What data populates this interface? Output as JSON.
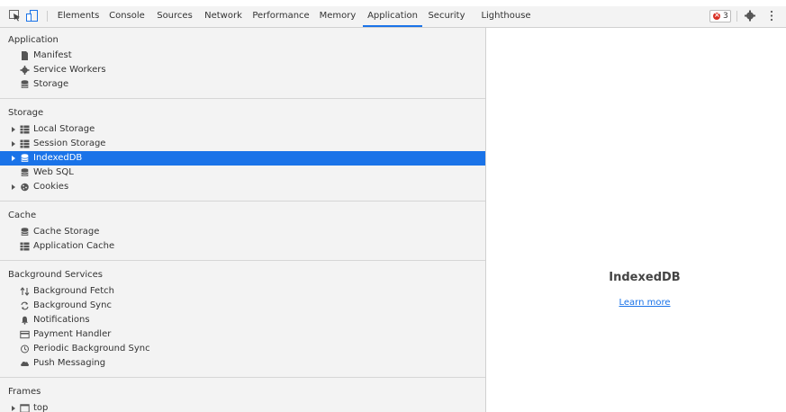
{
  "toolbar": {
    "tabs": [
      {
        "label": "Elements"
      },
      {
        "label": "Console"
      },
      {
        "label": "Sources"
      },
      {
        "label": "Network"
      },
      {
        "label": "Performance"
      },
      {
        "label": "Memory"
      },
      {
        "label": "Application"
      },
      {
        "label": "Security"
      },
      {
        "label": "Lighthouse"
      }
    ],
    "selected_tab": "Application",
    "error_count": "3"
  },
  "sidebar": {
    "application": {
      "heading": "Application",
      "items": [
        {
          "label": "Manifest",
          "icon": "file-icon"
        },
        {
          "label": "Service Workers",
          "icon": "gear-icon"
        },
        {
          "label": "Storage",
          "icon": "database-icon"
        }
      ]
    },
    "storage": {
      "heading": "Storage",
      "items": [
        {
          "label": "Local Storage",
          "icon": "grid-icon"
        },
        {
          "label": "Session Storage",
          "icon": "grid-icon"
        },
        {
          "label": "IndexedDB",
          "icon": "database-icon"
        },
        {
          "label": "Web SQL",
          "icon": "database-icon"
        },
        {
          "label": "Cookies",
          "icon": "cookie-icon"
        }
      ]
    },
    "cache": {
      "heading": "Cache",
      "items": [
        {
          "label": "Cache Storage",
          "icon": "database-icon"
        },
        {
          "label": "Application Cache",
          "icon": "grid-icon"
        }
      ]
    },
    "background_services": {
      "heading": "Background Services",
      "items": [
        {
          "label": "Background Fetch",
          "icon": "arrows-icon"
        },
        {
          "label": "Background Sync",
          "icon": "sync-icon"
        },
        {
          "label": "Notifications",
          "icon": "bell-icon"
        },
        {
          "label": "Payment Handler",
          "icon": "card-icon"
        },
        {
          "label": "Periodic Background Sync",
          "icon": "clock-icon"
        },
        {
          "label": "Push Messaging",
          "icon": "cloud-icon"
        }
      ]
    },
    "frames": {
      "heading": "Frames",
      "items": [
        {
          "label": "top",
          "icon": "frame-icon"
        }
      ]
    }
  },
  "main": {
    "title": "IndexedDB",
    "link": "Learn more"
  },
  "colors": {
    "accent": "#1a73e8",
    "error": "#d93025"
  }
}
